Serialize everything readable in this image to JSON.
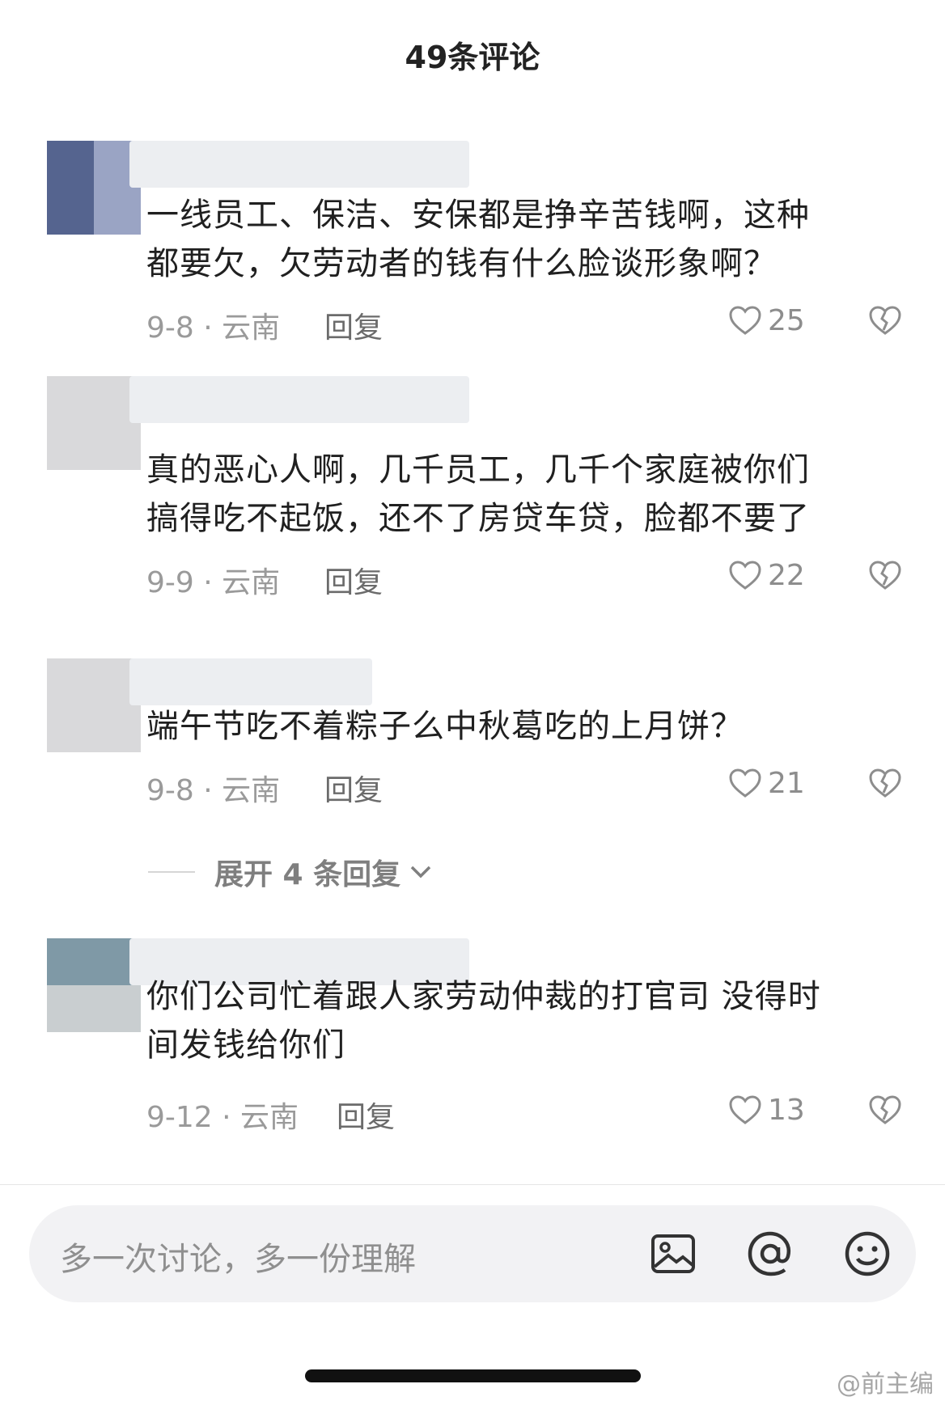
{
  "header": {
    "title": "49条评论"
  },
  "comments": [
    {
      "text_line1": "一线员工、保洁、安保都是挣辛苦钱啊，这种",
      "text_line2": "都要欠，欠劳动者的钱有什么脸谈形象啊？",
      "date": "9-8 · 云南",
      "reply": "回复",
      "likes": "25"
    },
    {
      "text_line1": "真的恶心人啊，几千员工，几千个家庭被你们",
      "text_line2": "搞得吃不起饭，还不了房贷车贷，脸都不要了",
      "date": "9-9 · 云南",
      "reply": "回复",
      "likes": "22"
    },
    {
      "text_line1": "端午节吃不着粽子么中秋葛吃的上月饼？",
      "text_line2": "",
      "date": "9-8 · 云南",
      "reply": "回复",
      "likes": "21"
    },
    {
      "text_line1": "你们公司忙着跟人家劳动仲裁的打官司 没得时",
      "text_line2": "间发钱给你们",
      "date": "9-12 · 云南",
      "reply": "回复",
      "likes": "13"
    }
  ],
  "expand": {
    "label": "展开 4 条回复"
  },
  "input": {
    "placeholder": "多一次讨论，多一份理解"
  },
  "icons": {
    "image": "image-icon",
    "at": "at-icon",
    "emoji": "emoji-icon",
    "like": "heart-icon",
    "dislike": "broken-heart-icon",
    "expand": "chevron-down-icon"
  },
  "watermark": "@前主编"
}
